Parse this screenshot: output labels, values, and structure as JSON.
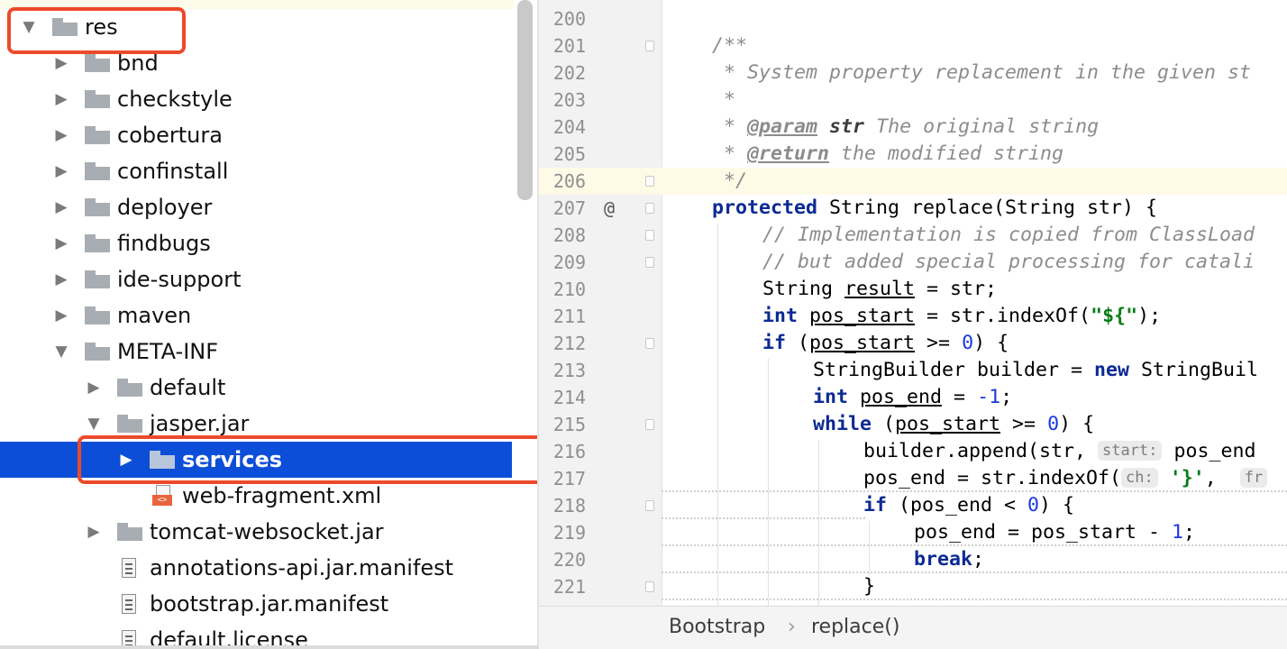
{
  "project_tree": {
    "items": [
      {
        "label": "res",
        "icon": "folder-icon",
        "expanded": true
      },
      {
        "label": "bnd",
        "icon": "folder-icon",
        "expanded": false
      },
      {
        "label": "checkstyle",
        "icon": "folder-icon",
        "expanded": false
      },
      {
        "label": "cobertura",
        "icon": "folder-icon",
        "expanded": false
      },
      {
        "label": "confinstall",
        "icon": "folder-icon",
        "expanded": false
      },
      {
        "label": "deployer",
        "icon": "folder-icon",
        "expanded": false
      },
      {
        "label": "findbugs",
        "icon": "folder-icon",
        "expanded": false
      },
      {
        "label": "ide-support",
        "icon": "folder-icon",
        "expanded": false
      },
      {
        "label": "maven",
        "icon": "folder-icon",
        "expanded": false
      },
      {
        "label": "META-INF",
        "icon": "folder-icon",
        "expanded": true
      },
      {
        "label": "default",
        "icon": "folder-icon",
        "expanded": false
      },
      {
        "label": "jasper.jar",
        "icon": "folder-icon",
        "expanded": true
      },
      {
        "label": "services",
        "icon": "folder-icon",
        "expanded": false,
        "selected": true
      },
      {
        "label": "web-fragment.xml",
        "icon": "xml-file-icon"
      },
      {
        "label": "tomcat-websocket.jar",
        "icon": "folder-icon",
        "expanded": false
      },
      {
        "label": "annotations-api.jar.manifest",
        "icon": "text-file-icon"
      },
      {
        "label": "bootstrap.jar.manifest",
        "icon": "text-file-icon"
      },
      {
        "label": "default.license",
        "icon": "text-file-icon"
      }
    ]
  },
  "editor": {
    "current_line": "206",
    "override_marker": "@",
    "line_numbers": [
      "200",
      "201",
      "202",
      "203",
      "204",
      "205",
      "206",
      "207",
      "208",
      "209",
      "210",
      "211",
      "212",
      "213",
      "214",
      "215",
      "216",
      "217",
      "218",
      "219",
      "220",
      "221"
    ],
    "tokens": {
      "l201": "/**",
      "l202": " * System property replacement in the given st",
      "l203": " *",
      "l204_star": " * ",
      "l204_tag": "@param",
      "l204_name": "str",
      "l204_rest": " The original string",
      "l205_star": " * ",
      "l205_tag": "@return",
      "l205_rest": " the modified string",
      "l206": " */",
      "l207_kw": "protected",
      "l207_rest": " String replace(String str) {",
      "l208": "// Implementation is copied from ClassLoad",
      "l209": "// but added special processing for catali",
      "l210_a": "String ",
      "l210_var": "result",
      "l210_b": " = str;",
      "l211_kw": "int",
      "l211_var": "pos_start",
      "l211_b": " = str.indexOf(",
      "l211_str": "\"${\"",
      "l211_c": ");",
      "l212_kw": "if",
      "l212_a": " (",
      "l212_var": "pos_start",
      "l212_b": " >= ",
      "l212_num": "0",
      "l212_c": ") {",
      "l213_a": "StringBuilder builder = ",
      "l213_kw": "new",
      "l213_b": " StringBuil",
      "l214_kw": "int",
      "l214_var": "pos_end",
      "l214_b": " = ",
      "l214_num": "-1",
      "l214_c": ";",
      "l215_kw": "while",
      "l215_a": " (",
      "l215_var": "pos_start",
      "l215_b": " >= ",
      "l215_num": "0",
      "l215_c": ") {",
      "l216_a": "builder.append(str, ",
      "l216_hint": "start:",
      "l216_b": " pos_end ",
      "l217_a": "pos_end = str.indexOf(",
      "l217_hint": "ch:",
      "l217_str": " '}'",
      "l217_b": ",  ",
      "l217_hint2": "fr",
      "l218_kw": "if",
      "l218_a": " (pos_end < ",
      "l218_num": "0",
      "l218_b": ") {",
      "l219_a": "pos_end = pos_start - ",
      "l219_num": "1",
      "l219_b": ";",
      "l220_kw": "break",
      "l220_b": ";",
      "l221": "}"
    }
  },
  "breadcrumb": {
    "items": [
      "Bootstrap",
      "replace()"
    ],
    "separator": "›"
  },
  "colors": {
    "selection": "#0d4ed8",
    "highlight_box": "#ec4a2a",
    "keyword": "#0b2a93",
    "number": "#1a38e0",
    "string": "#067d17",
    "comment": "#8c8c8c"
  }
}
